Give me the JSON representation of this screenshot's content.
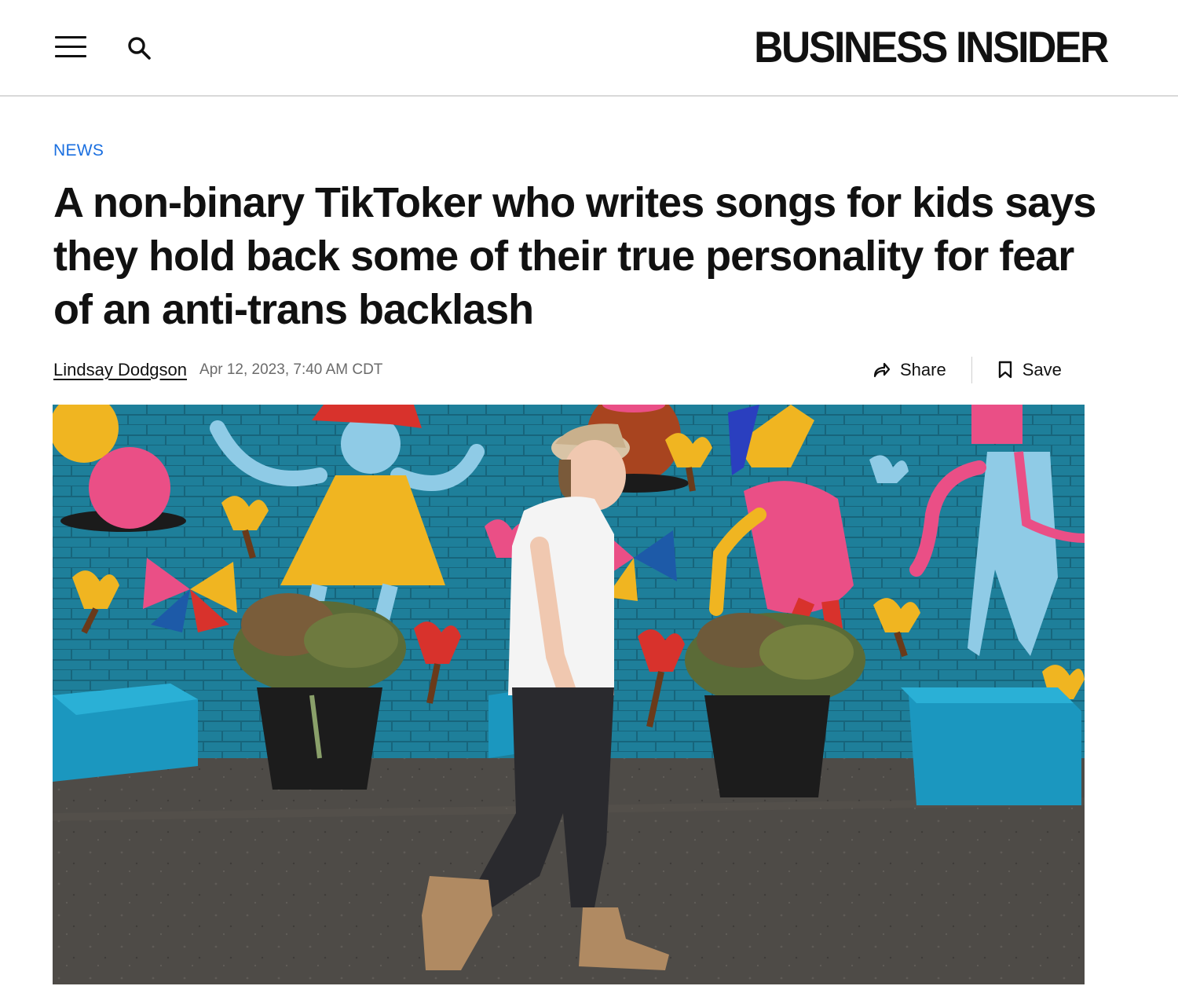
{
  "site": {
    "logo": "BUSINESS INSIDER"
  },
  "header": {
    "menu_icon": "hamburger-menu-icon",
    "search_icon": "search-icon"
  },
  "article": {
    "category": "NEWS",
    "headline": "A non-binary TikToker who writes songs for kids says they hold back some of their true personality for fear of an anti-trans backlash",
    "author": "Lindsay Dodgson",
    "date": "Apr 12, 2023, 7:40 AM CDT"
  },
  "actions": {
    "share_label": "Share",
    "share_icon": "share-arrow-icon",
    "save_label": "Save",
    "save_icon": "bookmark-icon"
  },
  "colors": {
    "category_link": "#1a6fe0",
    "mural_wall": "#1e7f9a"
  }
}
